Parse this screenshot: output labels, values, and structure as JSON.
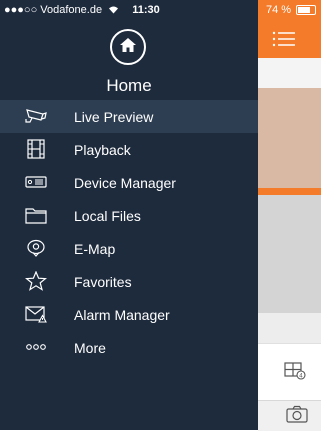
{
  "status_bar": {
    "carrier": "●●●○○ Vodafone.de",
    "time": "11:30",
    "battery": "74 %"
  },
  "drawer": {
    "title": "Home",
    "items": [
      {
        "label": "Live Preview",
        "icon": "cctv-camera-icon",
        "active": true
      },
      {
        "label": "Playback",
        "icon": "film-strip-icon",
        "active": false
      },
      {
        "label": "Device Manager",
        "icon": "dvr-device-icon",
        "active": false
      },
      {
        "label": "Local Files",
        "icon": "folder-icon",
        "active": false
      },
      {
        "label": "E-Map",
        "icon": "map-pin-icon",
        "active": false
      },
      {
        "label": "Favorites",
        "icon": "star-icon",
        "active": false
      },
      {
        "label": "Alarm Manager",
        "icon": "alarm-envelope-icon",
        "active": false
      },
      {
        "label": "More",
        "icon": "more-dots-icon",
        "active": false
      }
    ]
  },
  "colors": {
    "drawer_bg": "#1e2b3d",
    "active_row": "#2e3e52",
    "accent": "#f47b2a"
  }
}
